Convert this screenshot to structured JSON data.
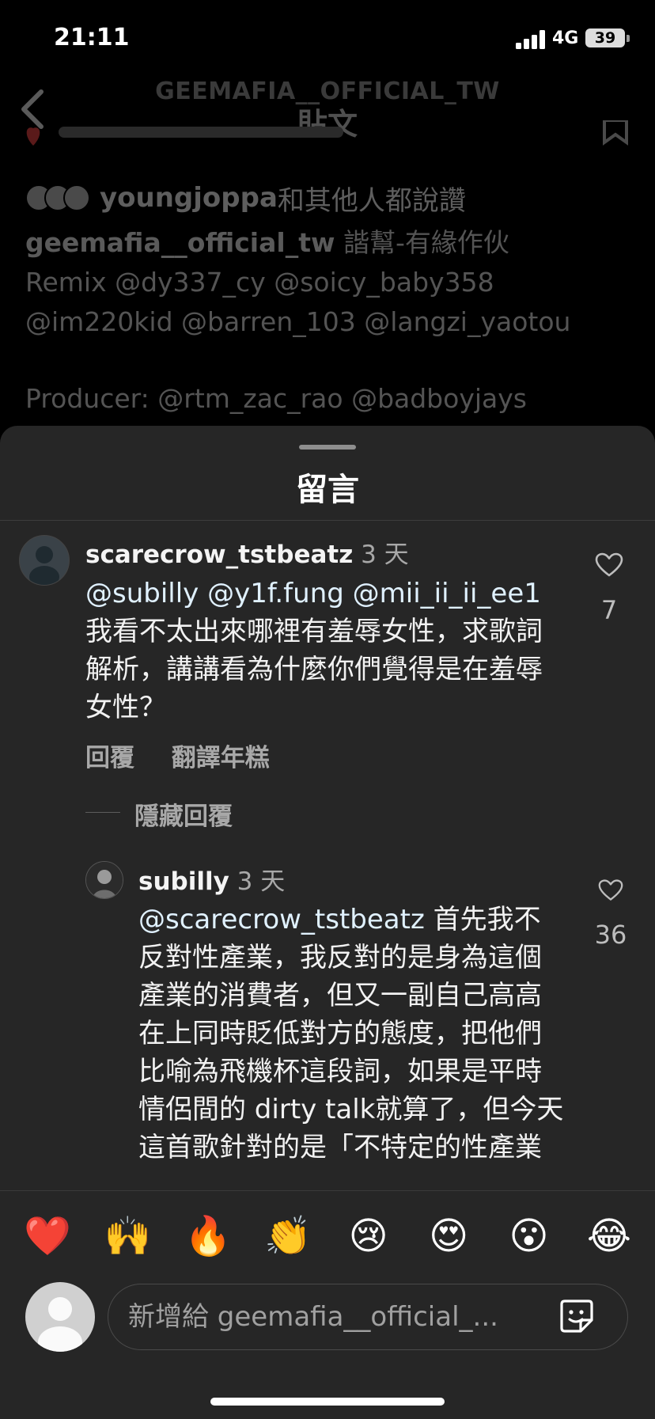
{
  "status_bar": {
    "time": "21:11",
    "network": "4G",
    "battery": "39"
  },
  "post": {
    "header_faded": "GEEMAFIA__OFFICIAL_TW",
    "title": "貼文",
    "liked_by_user": "youngjoppa",
    "liked_by_suffix": "和其他人都說讚",
    "caption_user": "geemafia__official_tw",
    "caption_lines": [
      "諧幫-有緣作伙",
      "Remix @dy337_cy  @soicy_baby358",
      "@im220kid  @barren_103  @langzi_yaotou"
    ],
    "producer": "Producer: @rtm_zac_rao @badboyjays"
  },
  "sheet": {
    "title": "留言"
  },
  "comments": [
    {
      "username": "scarecrow_tstbeatz",
      "time": "3 天",
      "mentions": "@subilly @y1f.fung @mii_ii_ii_ee1",
      "text": "我看不太出來哪裡有羞辱女性，求歌詞解析，講講看為什麼你們覺得是在羞辱女性？",
      "likes": "7",
      "reply_label": "回覆",
      "translate_label": "翻譯年糕",
      "hide_replies_label": "隱藏回覆"
    },
    {
      "username": "subilly",
      "time": "3 天",
      "mention": "@scarecrow_tstbeatz",
      "text": " 首先我不反對性產業，我反對的是身為這個產業的消費者，但又一副自己高高在上同時貶低對方的態度，把他們比喻為飛機杯這段詞，如果是平時情侶間的 dirty talk就算了，但今天這首歌針對的是「不特定的性產業",
      "likes": "36"
    }
  ],
  "emojis": [
    "❤️",
    "🙌",
    "🔥",
    "👏",
    "😢",
    "😍",
    "😮",
    "😂"
  ],
  "composer": {
    "placeholder": "新增給 geemafia__official_..."
  },
  "icons": {
    "back": "chevron-left-icon",
    "like": "heart-outline-icon",
    "sticker": "sticker-icon"
  },
  "colors": {
    "sheet_bg": "#262626",
    "mention": "#e0f1ff",
    "muted": "#a8a8a8"
  }
}
